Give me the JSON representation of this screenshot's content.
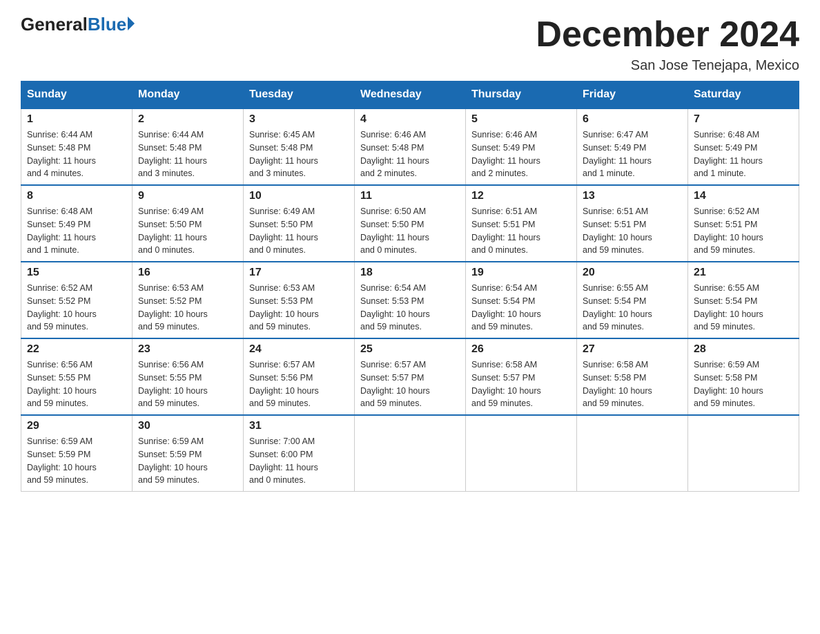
{
  "header": {
    "logo_general": "General",
    "logo_blue": "Blue",
    "month_title": "December 2024",
    "location": "San Jose Tenejapa, Mexico"
  },
  "days_of_week": [
    "Sunday",
    "Monday",
    "Tuesday",
    "Wednesday",
    "Thursday",
    "Friday",
    "Saturday"
  ],
  "weeks": [
    [
      {
        "day": "1",
        "info": "Sunrise: 6:44 AM\nSunset: 5:48 PM\nDaylight: 11 hours\nand 4 minutes."
      },
      {
        "day": "2",
        "info": "Sunrise: 6:44 AM\nSunset: 5:48 PM\nDaylight: 11 hours\nand 3 minutes."
      },
      {
        "day": "3",
        "info": "Sunrise: 6:45 AM\nSunset: 5:48 PM\nDaylight: 11 hours\nand 3 minutes."
      },
      {
        "day": "4",
        "info": "Sunrise: 6:46 AM\nSunset: 5:48 PM\nDaylight: 11 hours\nand 2 minutes."
      },
      {
        "day": "5",
        "info": "Sunrise: 6:46 AM\nSunset: 5:49 PM\nDaylight: 11 hours\nand 2 minutes."
      },
      {
        "day": "6",
        "info": "Sunrise: 6:47 AM\nSunset: 5:49 PM\nDaylight: 11 hours\nand 1 minute."
      },
      {
        "day": "7",
        "info": "Sunrise: 6:48 AM\nSunset: 5:49 PM\nDaylight: 11 hours\nand 1 minute."
      }
    ],
    [
      {
        "day": "8",
        "info": "Sunrise: 6:48 AM\nSunset: 5:49 PM\nDaylight: 11 hours\nand 1 minute."
      },
      {
        "day": "9",
        "info": "Sunrise: 6:49 AM\nSunset: 5:50 PM\nDaylight: 11 hours\nand 0 minutes."
      },
      {
        "day": "10",
        "info": "Sunrise: 6:49 AM\nSunset: 5:50 PM\nDaylight: 11 hours\nand 0 minutes."
      },
      {
        "day": "11",
        "info": "Sunrise: 6:50 AM\nSunset: 5:50 PM\nDaylight: 11 hours\nand 0 minutes."
      },
      {
        "day": "12",
        "info": "Sunrise: 6:51 AM\nSunset: 5:51 PM\nDaylight: 11 hours\nand 0 minutes."
      },
      {
        "day": "13",
        "info": "Sunrise: 6:51 AM\nSunset: 5:51 PM\nDaylight: 10 hours\nand 59 minutes."
      },
      {
        "day": "14",
        "info": "Sunrise: 6:52 AM\nSunset: 5:51 PM\nDaylight: 10 hours\nand 59 minutes."
      }
    ],
    [
      {
        "day": "15",
        "info": "Sunrise: 6:52 AM\nSunset: 5:52 PM\nDaylight: 10 hours\nand 59 minutes."
      },
      {
        "day": "16",
        "info": "Sunrise: 6:53 AM\nSunset: 5:52 PM\nDaylight: 10 hours\nand 59 minutes."
      },
      {
        "day": "17",
        "info": "Sunrise: 6:53 AM\nSunset: 5:53 PM\nDaylight: 10 hours\nand 59 minutes."
      },
      {
        "day": "18",
        "info": "Sunrise: 6:54 AM\nSunset: 5:53 PM\nDaylight: 10 hours\nand 59 minutes."
      },
      {
        "day": "19",
        "info": "Sunrise: 6:54 AM\nSunset: 5:54 PM\nDaylight: 10 hours\nand 59 minutes."
      },
      {
        "day": "20",
        "info": "Sunrise: 6:55 AM\nSunset: 5:54 PM\nDaylight: 10 hours\nand 59 minutes."
      },
      {
        "day": "21",
        "info": "Sunrise: 6:55 AM\nSunset: 5:54 PM\nDaylight: 10 hours\nand 59 minutes."
      }
    ],
    [
      {
        "day": "22",
        "info": "Sunrise: 6:56 AM\nSunset: 5:55 PM\nDaylight: 10 hours\nand 59 minutes."
      },
      {
        "day": "23",
        "info": "Sunrise: 6:56 AM\nSunset: 5:55 PM\nDaylight: 10 hours\nand 59 minutes."
      },
      {
        "day": "24",
        "info": "Sunrise: 6:57 AM\nSunset: 5:56 PM\nDaylight: 10 hours\nand 59 minutes."
      },
      {
        "day": "25",
        "info": "Sunrise: 6:57 AM\nSunset: 5:57 PM\nDaylight: 10 hours\nand 59 minutes."
      },
      {
        "day": "26",
        "info": "Sunrise: 6:58 AM\nSunset: 5:57 PM\nDaylight: 10 hours\nand 59 minutes."
      },
      {
        "day": "27",
        "info": "Sunrise: 6:58 AM\nSunset: 5:58 PM\nDaylight: 10 hours\nand 59 minutes."
      },
      {
        "day": "28",
        "info": "Sunrise: 6:59 AM\nSunset: 5:58 PM\nDaylight: 10 hours\nand 59 minutes."
      }
    ],
    [
      {
        "day": "29",
        "info": "Sunrise: 6:59 AM\nSunset: 5:59 PM\nDaylight: 10 hours\nand 59 minutes."
      },
      {
        "day": "30",
        "info": "Sunrise: 6:59 AM\nSunset: 5:59 PM\nDaylight: 10 hours\nand 59 minutes."
      },
      {
        "day": "31",
        "info": "Sunrise: 7:00 AM\nSunset: 6:00 PM\nDaylight: 11 hours\nand 0 minutes."
      },
      {
        "day": "",
        "info": ""
      },
      {
        "day": "",
        "info": ""
      },
      {
        "day": "",
        "info": ""
      },
      {
        "day": "",
        "info": ""
      }
    ]
  ]
}
